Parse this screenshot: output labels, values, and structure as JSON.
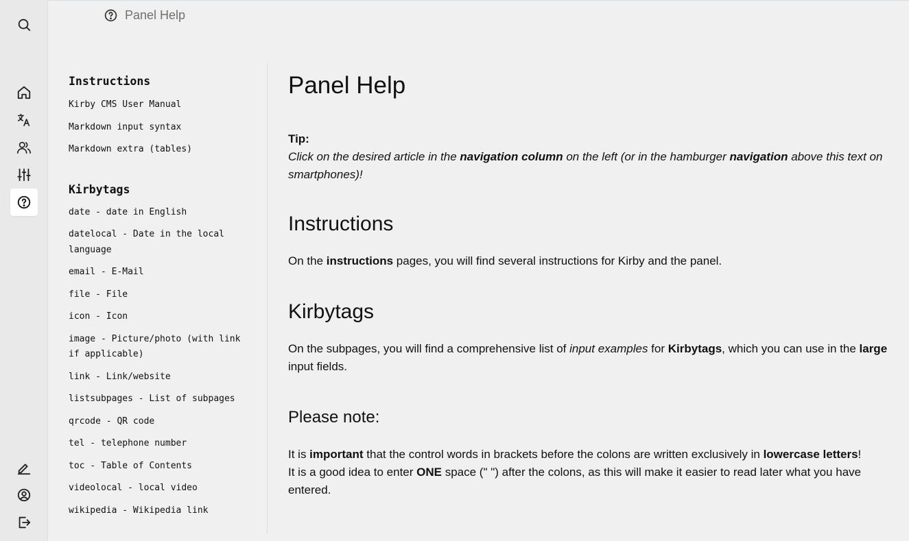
{
  "breadcrumb": {
    "icon": "help-circle-icon",
    "label": "Panel Help"
  },
  "rail": {
    "top": [
      {
        "name": "search",
        "icon": "search-icon"
      }
    ],
    "main": [
      {
        "name": "home",
        "icon": "home-icon"
      },
      {
        "name": "languages",
        "icon": "translate-icon"
      },
      {
        "name": "users",
        "icon": "users-icon"
      },
      {
        "name": "settings",
        "icon": "sliders-icon"
      },
      {
        "name": "help",
        "icon": "help-circle-icon",
        "active": true
      }
    ],
    "bottom": [
      {
        "name": "edit",
        "icon": "pencil-icon"
      },
      {
        "name": "account",
        "icon": "user-circle-icon"
      },
      {
        "name": "logout",
        "icon": "logout-icon"
      }
    ]
  },
  "sidenav": {
    "groups": [
      {
        "heading": "Instructions",
        "items": [
          "Kirby CMS User Manual",
          "Markdown input syntax",
          "Markdown extra (tables)"
        ]
      },
      {
        "heading": "Kirbytags",
        "items": [
          "date - date in English",
          "datelocal - Date in the local language",
          "email - E-Mail",
          "file - File",
          "icon - Icon",
          "image - Picture/photo (with link if applicable)",
          "link - Link/website",
          "listsubpages - List of subpages",
          "qrcode - QR code",
          "tel - telephone number",
          "toc - Table of Contents",
          "videolocal - local video",
          "wikipedia - Wikipedia link"
        ]
      }
    ]
  },
  "article": {
    "title": "Panel Help",
    "tip": {
      "label": "Tip:",
      "t1": "Click on the desired article in the ",
      "b1": "navigation column",
      "t2": " on the left (or in the hamburger ",
      "b2": "navigation",
      "t3": " above this text on smartphones)!"
    },
    "instructions": {
      "heading": "Instructions",
      "t1": "On the ",
      "b1": "instructions",
      "t2": " pages, you will find several instructions for Kirby and the panel."
    },
    "kirbytags": {
      "heading": "Kirbytags",
      "t1": "On the subpages, you will find a comprehensive list of ",
      "i1": "input examples",
      "t2": " for ",
      "b1": "Kirbytags",
      "t3": ", which you can use in the ",
      "b2": "large",
      "t4": " input fields."
    },
    "note": {
      "heading": "Please note:",
      "t1": "It is ",
      "b1": "important",
      "t2": " that the control words in brackets before the colons are written exclusively in ",
      "b2": "lowercase letters",
      "t3": "!",
      "t4": "It is a good idea to enter ",
      "b3": "ONE",
      "t5": " space (\" \") after the colons, as this will make it easier to read later what you have entered."
    }
  }
}
